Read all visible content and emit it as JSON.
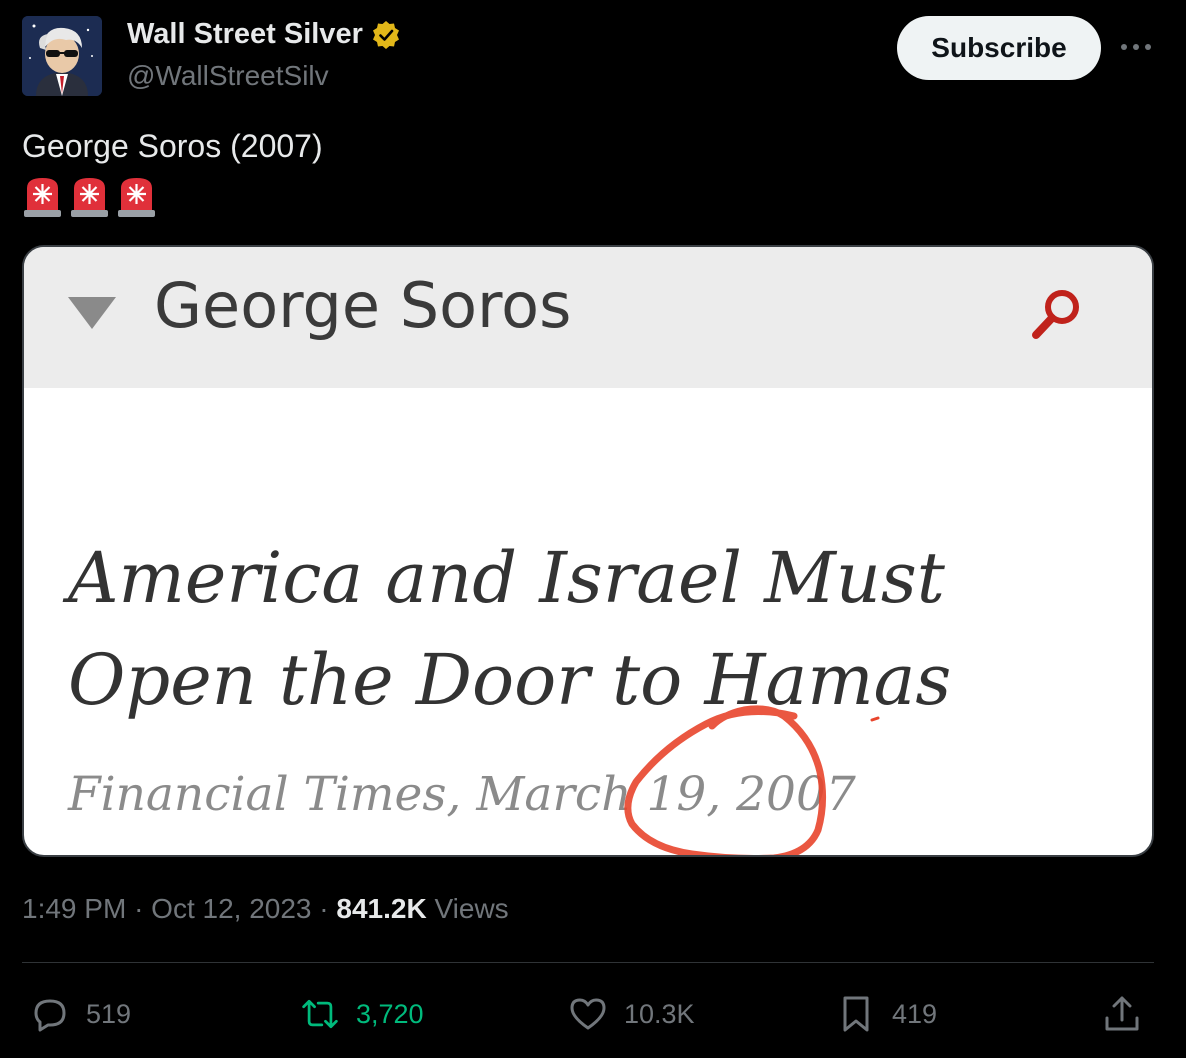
{
  "author": {
    "name": "Wall Street Silver",
    "handle": "@WallStreetSilv"
  },
  "actions": {
    "subscribe_label": "Subscribe"
  },
  "tweet": {
    "text": "George Soros (2007)",
    "emoji": "🚨🚨🚨"
  },
  "card": {
    "header_title": "George Soros",
    "headline": "America and Israel Must Open the Door to Hamas",
    "source": "Financial Times, March 19, 2007"
  },
  "meta": {
    "time": "1:49 PM",
    "date": "Oct 12, 2023",
    "views_count": "841.2K",
    "views_label": "Views",
    "separator": "·"
  },
  "stats": {
    "replies": "519",
    "reposts": "3,720",
    "likes": "10.3K",
    "bookmarks": "419"
  },
  "colors": {
    "accent_green": "#00ba7c",
    "verified_gold": "#e2b719",
    "siren_red": "#e0303a",
    "highlight_red": "#e8452c"
  },
  "icons": [
    "verified-badge-icon",
    "more-options-icon",
    "siren-icon",
    "dropdown-triangle-icon",
    "search-icon",
    "reply-icon",
    "repost-icon",
    "like-icon",
    "bookmark-icon",
    "share-icon"
  ]
}
